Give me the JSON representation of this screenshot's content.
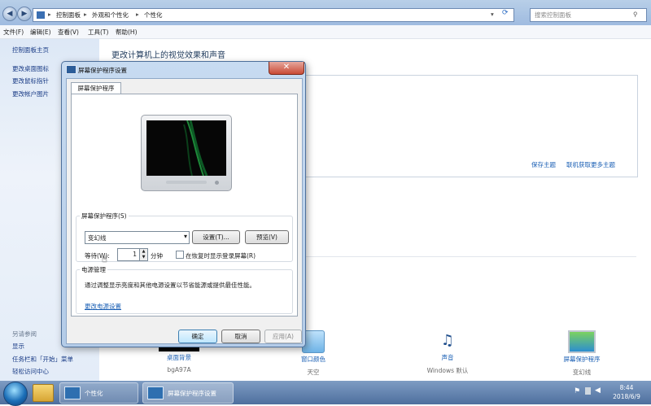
{
  "address_bar": {
    "crumbs": [
      "控制面板",
      "外观和个性化",
      "个性化"
    ],
    "separator": "▸",
    "search_placeholder": "搜索控制面板"
  },
  "menubar": [
    "文件(F)",
    "编辑(E)",
    "查看(V)",
    "工具(T)",
    "帮助(H)"
  ],
  "left_panel": {
    "home": "控制面板主页",
    "links": [
      "更改桌面图标",
      "更改鼠标指针",
      "更改帐户图片"
    ],
    "see_also_heading": "另请参阅",
    "see_also": [
      "显示",
      "任务栏和「开始」菜单",
      "轻松访问中心"
    ]
  },
  "main": {
    "title": "更改计算机上的视觉效果和声音",
    "save_theme": "保存主题",
    "get_more_themes": "联机获取更多主题",
    "bottom_items": [
      {
        "label": "桌面背景",
        "sub": "bgA97A"
      },
      {
        "label": "窗口颜色",
        "sub": "天空"
      },
      {
        "label": "声音",
        "sub": "Windows 默认"
      },
      {
        "label": "屏幕保护程序",
        "sub": "变幻线"
      }
    ]
  },
  "dialog": {
    "title": "屏幕保护程序设置",
    "close_glyph": "✕",
    "tab": "屏幕保护程序",
    "saver_group": "屏幕保护程序(S)",
    "saver_selected": "变幻线",
    "settings_button": "设置(T)...",
    "preview_button": "预览(V)",
    "wait_label": "等待(W):",
    "wait_value": "1",
    "wait_unit": "分钟",
    "resume_label": "在恢复时显示登录屏幕(R)",
    "resume_checked": false,
    "power_group": "电源管理",
    "power_text": "通过调整显示亮度和其他电源设置以节省能源或提供最佳性能。",
    "power_link": "更改电源设置",
    "ok": "确定",
    "cancel": "取消",
    "apply": "应用(A)"
  },
  "taskbar": {
    "buttons": [
      "个性化",
      "屏幕保护程序设置"
    ],
    "time": "8:44",
    "date": "2018/6/9"
  }
}
